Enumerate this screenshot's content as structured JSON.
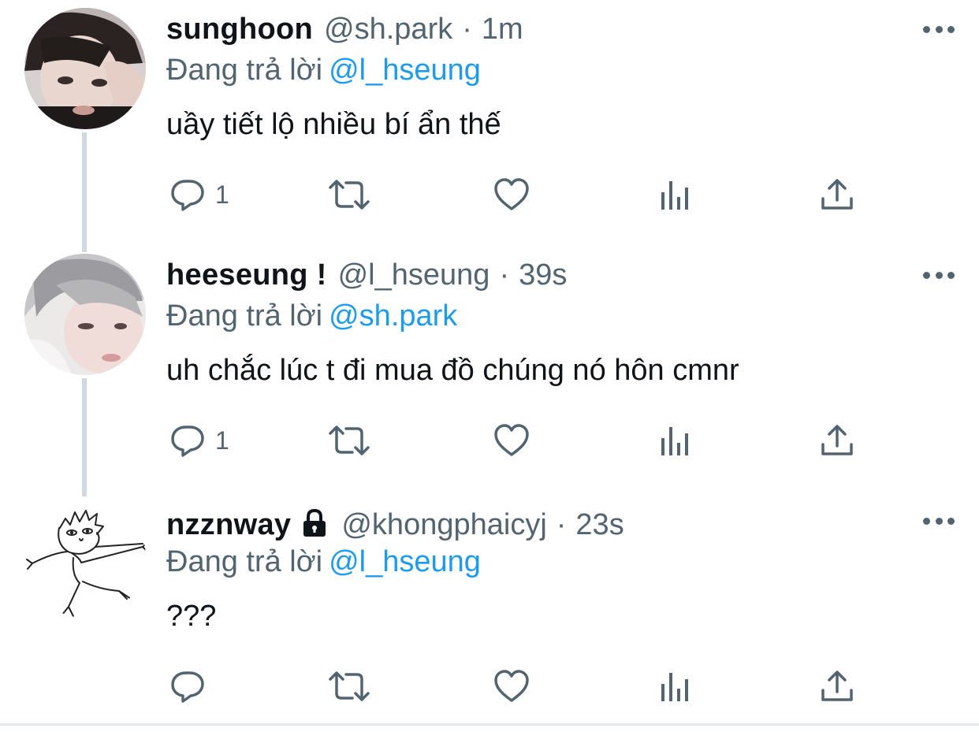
{
  "replying_prefix": "Đang trả lời",
  "tweets": [
    {
      "display_name": "sunghoon",
      "handle": "@sh.park",
      "separator": "·",
      "time": "1m",
      "replying_to": "@l_hseung",
      "text": "uầy tiết lộ nhiều bí ẩn thế",
      "reply_count": "1",
      "avatar_icon": "profile-photo-avatar"
    },
    {
      "display_name": "heeseung !",
      "handle": "@l_hseung",
      "separator": "·",
      "time": "39s",
      "replying_to": "@sh.park",
      "text": "uh chắc lúc t đi mua đồ chúng nó hôn cmnr",
      "reply_count": "1",
      "avatar_icon": "profile-photo-avatar"
    },
    {
      "display_name": "nzznway",
      "handle": "@khongphaicyj",
      "separator": "·",
      "time": "23s",
      "replying_to": "@l_hseung",
      "text": "???",
      "reply_count": "",
      "protected": true,
      "avatar_icon": "doodle-avatar"
    }
  ],
  "icons": {
    "reply": "reply-icon",
    "retweet": "retweet-icon",
    "like": "like-icon",
    "views": "views-icon",
    "share": "share-icon",
    "more": "more-icon",
    "lock": "lock-icon"
  },
  "colors": {
    "text": "#0f1419",
    "secondary": "#536471",
    "link": "#1d9bf0",
    "thread_line": "#cfd9de"
  }
}
